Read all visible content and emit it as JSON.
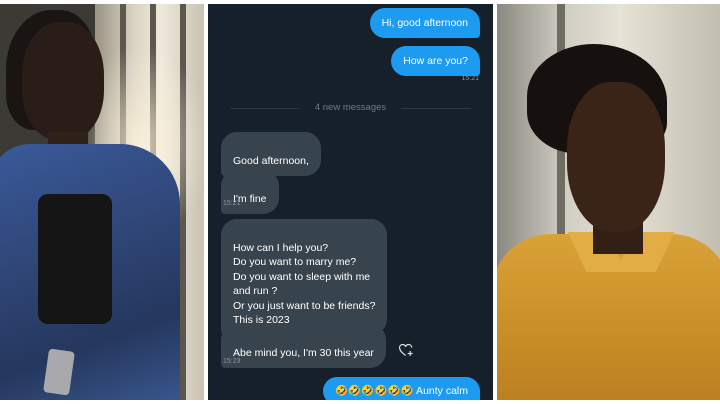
{
  "chat": {
    "outgoing_top": [
      {
        "text": "Hi, good afternoon"
      },
      {
        "text": "How are you?"
      }
    ],
    "time_1": "15:21",
    "divider": "4 new messages",
    "incoming": [
      {
        "text": "Good afternoon,"
      },
      {
        "text": "I'm fine"
      }
    ],
    "time_2": "15:21",
    "long_message": "How can I help you?\nDo you want to marry me?\nDo you want to sleep with me\nand run ?\nOr you just want to be friends?\nThis is 2023",
    "last_incoming": "Abe mind you, I'm 30 this year",
    "time_3": "15:23",
    "reply": "🤣🤣🤣🤣🤣🤣  Aunty calm"
  },
  "colors": {
    "background": "#15202b",
    "outgoing_bubble": "#1d9bf0",
    "incoming_bubble": "#38444d",
    "meta_text": "#8b98a5"
  },
  "icons": {
    "reaction": "heart-add-icon"
  }
}
